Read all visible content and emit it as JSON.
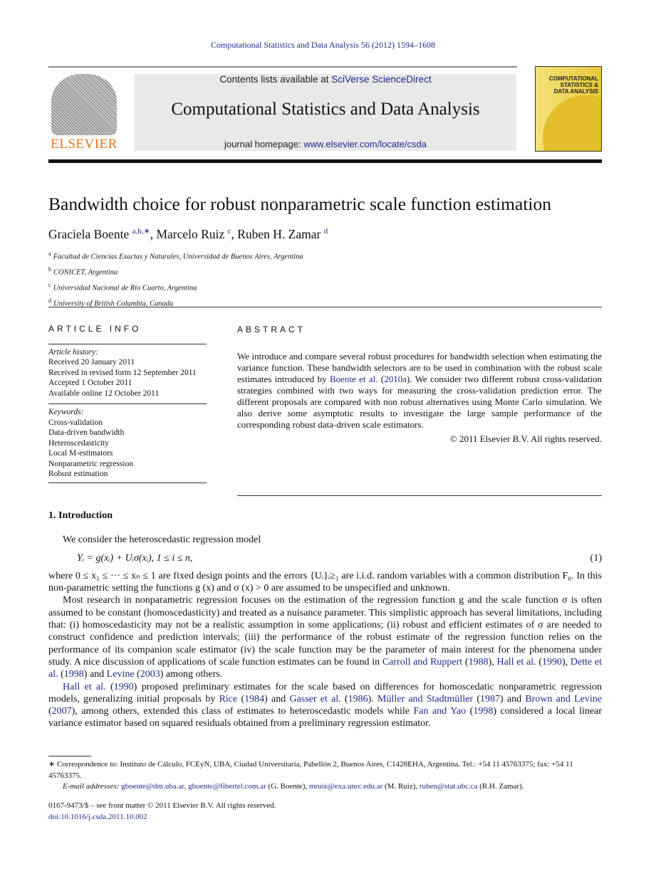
{
  "header": {
    "running_head": "Computational Statistics and Data Analysis 56 (2012) 1594–1608",
    "publisher_logo_text": "ELSEVIER",
    "contents_prefix": "Contents lists available at ",
    "contents_link": "SciVerse ScienceDirect",
    "journal_title": "Computational Statistics and Data Analysis",
    "homepage_prefix": "journal homepage: ",
    "homepage_link": "www.elsevier.com/locate/csda",
    "cover_text": "COMPUTATIONAL STATISTICS & DATA ANALYSIS"
  },
  "article": {
    "title": "Bandwidth choice for robust nonparametric scale function estimation",
    "authors": [
      {
        "name": "Graciela Boente ",
        "sup": "a,b,∗"
      },
      {
        "name": ", Marcelo Ruiz ",
        "sup": "c"
      },
      {
        "name": ", Ruben H. Zamar ",
        "sup": "d"
      }
    ],
    "affiliations": [
      {
        "sup": "a",
        "text": "Facultad de Ciencias Exactas y Naturales, Universidad de Buenos Aires, Argentina"
      },
      {
        "sup": "b",
        "text": "CONICET, Argentina"
      },
      {
        "sup": "c",
        "text": "Universidad Nacional de Río Cuarto, Argentina"
      },
      {
        "sup": "d",
        "text": "University of British Columbia, Canada"
      }
    ]
  },
  "article_info": {
    "heading": "ARTICLE INFO",
    "history_label": "Article history:",
    "history": [
      "Received 20 January 2011",
      "Received in revised form 12 September 2011",
      "Accepted 1 October 2011",
      "Available online 12 October 2011"
    ],
    "keywords_label": "Keywords:",
    "keywords": [
      "Cross-validation",
      "Data-driven bandwidth",
      "Heteroscedasticity",
      "Local M-estimators",
      "Nonparametric regression",
      "Robust estimation"
    ]
  },
  "abstract": {
    "heading": "ABSTRACT",
    "text": [
      {
        "t": "We introduce and compare several robust procedures for bandwidth selection when estimating the variance function. These bandwidth selectors are to be used in combination with the robust scale estimates introduced by "
      },
      {
        "t": "Boente et al.",
        "link": true
      },
      {
        "t": " ("
      },
      {
        "t": "2010a",
        "link": true
      },
      {
        "t": "). We consider two different robust cross-validation strategies combined with two ways for measuring the cross-validation prediction error. The different proposals are compared with non robust alternatives using Monte Carlo simulation. We also derive some asymptotic results to investigate the large sample performance of the corresponding robust data-driven scale estimators."
      }
    ],
    "copyright": "© 2011 Elsevier B.V. All rights reserved."
  },
  "intro": {
    "heading": "1.  Introduction",
    "p1": "We consider the heteroscedastic regression model",
    "equation": "Yᵢ = g(xᵢ) + Uᵢσ(xᵢ),    1 ≤ i ≤ n,",
    "equation_number": "(1)",
    "p2": [
      {
        "t": "where 0 ≤ x₁ ≤ ··· ≤ xₙ ≤ 1 are fixed design points and the errors {Uᵢ}ᵢ≥₁ are i.i.d. random variables with a common distribution F₀. In this non-parametric setting the functions g (x) and σ (x) > 0 are assumed to be unspecified and unknown."
      }
    ],
    "p3": [
      {
        "t": "Most research in nonparametric regression focuses on the estimation of the regression function g and the scale function σ is often assumed to be constant (homoscedasticity) and treated as a nuisance parameter. This simplistic approach has several limitations, including that: (i) homoscedasticity may not be a realistic assumption in some applications; (ii) robust and efficient estimates of σ are needed to construct confidence and prediction intervals; (iii) the performance of the robust estimate of the regression function relies on the performance of its companion scale estimator (iv) the scale function may be the parameter of main interest for the phenomena under study. A nice discussion of applications of scale function estimates can be found in "
      },
      {
        "t": "Carroll and Ruppert",
        "link": true
      },
      {
        "t": " ("
      },
      {
        "t": "1988",
        "link": true
      },
      {
        "t": "), "
      },
      {
        "t": "Hall et al.",
        "link": true
      },
      {
        "t": " ("
      },
      {
        "t": "1990",
        "link": true
      },
      {
        "t": "), "
      },
      {
        "t": "Dette et al.",
        "link": true
      },
      {
        "t": " ("
      },
      {
        "t": "1998",
        "link": true
      },
      {
        "t": ") and "
      },
      {
        "t": "Levine",
        "link": true
      },
      {
        "t": " ("
      },
      {
        "t": "2003",
        "link": true
      },
      {
        "t": ") among others."
      }
    ],
    "p4": [
      {
        "t": "Hall et al.",
        "link": true
      },
      {
        "t": " ("
      },
      {
        "t": "1990",
        "link": true
      },
      {
        "t": ") proposed preliminary estimates for the scale based on differences for homoscedatic nonparametric regression models, generalizing initial proposals by "
      },
      {
        "t": "Rice",
        "link": true
      },
      {
        "t": " ("
      },
      {
        "t": "1984",
        "link": true
      },
      {
        "t": ") and "
      },
      {
        "t": "Gasser et al.",
        "link": true
      },
      {
        "t": " ("
      },
      {
        "t": "1986",
        "link": true
      },
      {
        "t": "). "
      },
      {
        "t": "Müller and Stadtmüller",
        "link": true
      },
      {
        "t": " ("
      },
      {
        "t": "1987",
        "link": true
      },
      {
        "t": ") and "
      },
      {
        "t": "Brown and Levine",
        "link": true
      },
      {
        "t": " ("
      },
      {
        "t": "2007",
        "link": true
      },
      {
        "t": "), among others, extended this class of estimates to heteroscedastic models while "
      },
      {
        "t": "Fan and Yao",
        "link": true
      },
      {
        "t": " ("
      },
      {
        "t": "1998",
        "link": true
      },
      {
        "t": ") considered a local linear variance estimator based on squared residuals obtained from a preliminary regression estimator."
      }
    ]
  },
  "footnotes": {
    "correspondence": [
      {
        "t": "  ∗  Correspondence to: Instituto de Cálculo, FCEyN, UBA, Ciudad Universitaria, Pabellón 2, Buenos Aires, C1428EHA, Argentina. Tel.: +54 11 45763375; fax: +54 11 45763375."
      }
    ],
    "emails": [
      {
        "t": "E-mail addresses: ",
        "italic": true
      },
      {
        "t": "gboente@dm.uba.ar",
        "link": true
      },
      {
        "t": ", "
      },
      {
        "t": "gboente@fibertel.com.ar",
        "link": true
      },
      {
        "t": " (G. Boente), "
      },
      {
        "t": "mruiz@exa.unrc.edu.ar",
        "link": true
      },
      {
        "t": " (M. Ruiz), "
      },
      {
        "t": "ruben@stat.ubc.ca",
        "link": true
      },
      {
        "t": " (R.H. Zamar)."
      }
    ],
    "front_matter": "0167-9473/$ – see front matter © 2011 Elsevier B.V. All rights reserved.",
    "doi": "doi:10.1016/j.csda.2011.10.002"
  }
}
